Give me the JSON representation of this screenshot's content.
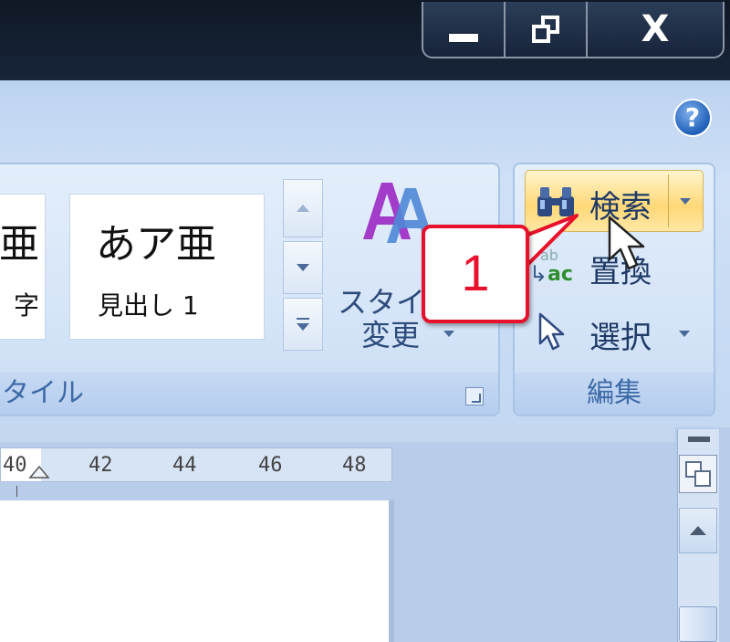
{
  "window_controls": {
    "minimize_icon": "minimize-icon",
    "restore_icon": "restore-icon",
    "close_icon": "close-icon",
    "close_glyph": "X"
  },
  "ribbon": {
    "help_glyph": "?",
    "styles_group": {
      "label": "タイル",
      "tiles": [
        {
          "preview": "亜",
          "name": "字"
        },
        {
          "preview": "あア亜",
          "name": "見出し 1"
        }
      ],
      "change_styles": {
        "line1": "スタイ",
        "line2": "変更"
      }
    },
    "edit_group": {
      "label": "編集",
      "find": "検索",
      "replace": "置換",
      "select": "選択",
      "replace_icon_text": {
        "ab": "ab",
        "ac": "ac"
      }
    }
  },
  "callout": {
    "number": "1",
    "color": "#e8102a"
  },
  "ruler": {
    "ticks": [
      "40",
      "42",
      "44",
      "46",
      "48"
    ]
  },
  "colors": {
    "titlebar": "#0f1825",
    "ribbon": "#cfe0f6",
    "find_highlight": "#ffd877",
    "group_label": "#3e6aa7"
  }
}
